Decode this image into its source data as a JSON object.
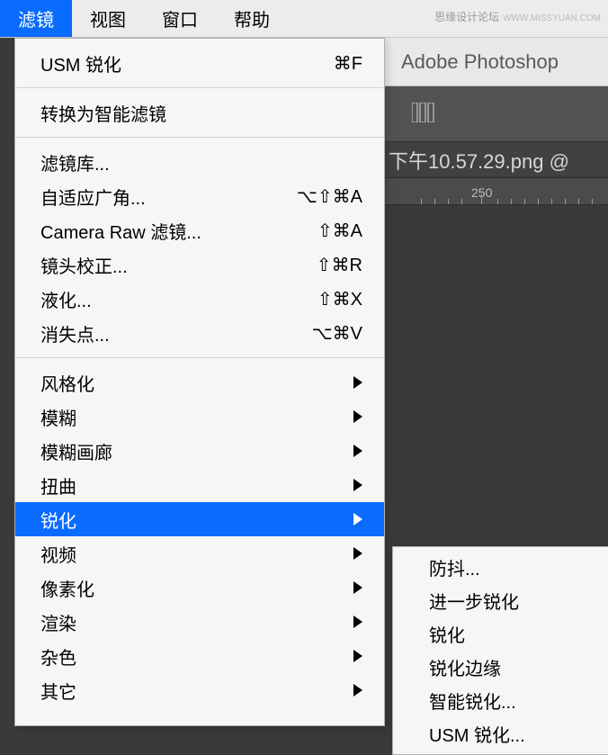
{
  "watermark": {
    "text": "思缘设计论坛",
    "url": "WWW.MISSYUAN.COM"
  },
  "menubar": {
    "items": [
      {
        "id": "filter",
        "label": "滤镜",
        "active": true
      },
      {
        "id": "view",
        "label": "视图"
      },
      {
        "id": "window",
        "label": "窗口"
      },
      {
        "id": "help",
        "label": "帮助"
      }
    ]
  },
  "app": {
    "title": "Adobe Photoshop",
    "doc_title": "下午10.57.29.png @",
    "ruler_mark": "250"
  },
  "filter_menu": {
    "sections": [
      [
        {
          "id": "usm",
          "label": "USM 锐化",
          "shortcut": "⌘F"
        }
      ],
      [
        {
          "id": "smart",
          "label": "转换为智能滤镜"
        }
      ],
      [
        {
          "id": "gallery",
          "label": "滤镜库..."
        },
        {
          "id": "adaptive",
          "label": "自适应广角...",
          "shortcut": "⌥⇧⌘A"
        },
        {
          "id": "cameraraw",
          "label": "Camera Raw 滤镜...",
          "shortcut": "⇧⌘A"
        },
        {
          "id": "lens",
          "label": "镜头校正...",
          "shortcut": "⇧⌘R"
        },
        {
          "id": "liquify",
          "label": "液化...",
          "shortcut": "⇧⌘X"
        },
        {
          "id": "vanish",
          "label": "消失点...",
          "shortcut": "⌥⌘V"
        }
      ],
      [
        {
          "id": "stylize",
          "label": "风格化",
          "submenu": true
        },
        {
          "id": "blur",
          "label": "模糊",
          "submenu": true
        },
        {
          "id": "blurgallery",
          "label": "模糊画廊",
          "submenu": true
        },
        {
          "id": "distort",
          "label": "扭曲",
          "submenu": true
        },
        {
          "id": "sharpen",
          "label": "锐化",
          "submenu": true,
          "highlighted": true
        },
        {
          "id": "video",
          "label": "视频",
          "submenu": true
        },
        {
          "id": "pixelate",
          "label": "像素化",
          "submenu": true
        },
        {
          "id": "render",
          "label": "渲染",
          "submenu": true
        },
        {
          "id": "noise",
          "label": "杂色",
          "submenu": true
        },
        {
          "id": "other",
          "label": "其它",
          "submenu": true
        }
      ]
    ]
  },
  "sharpen_submenu": {
    "items": [
      {
        "id": "shake",
        "label": "防抖..."
      },
      {
        "id": "more",
        "label": "进一步锐化"
      },
      {
        "id": "sharpen",
        "label": "锐化"
      },
      {
        "id": "edges",
        "label": "锐化边缘"
      },
      {
        "id": "smart",
        "label": "智能锐化..."
      },
      {
        "id": "usm",
        "label": "USM 锐化..."
      }
    ]
  }
}
